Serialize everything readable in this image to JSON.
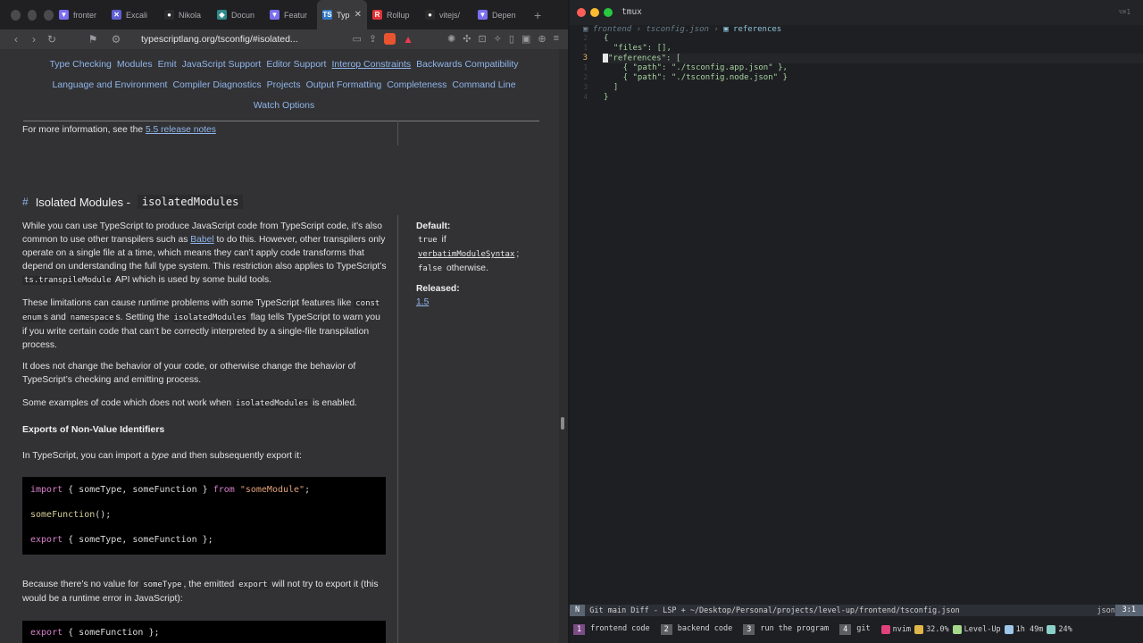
{
  "browser": {
    "tabs": [
      {
        "label": "fronter",
        "color": "#7a6ef0",
        "glyph": "▼"
      },
      {
        "label": "Excali",
        "color": "#5f5fd4",
        "glyph": "✕"
      },
      {
        "label": "Nikola",
        "color": "#2a2a2a",
        "glyph": "●"
      },
      {
        "label": "Docun",
        "color": "#2d8a8a",
        "glyph": "◆"
      },
      {
        "label": "Featur",
        "color": "#7a6ef0",
        "glyph": "▼"
      },
      {
        "label": "Typ",
        "color": "#3178c6",
        "glyph": "TS",
        "active": true
      },
      {
        "label": "Rollup",
        "color": "#e23237",
        "glyph": "R"
      },
      {
        "label": "vitejs/",
        "color": "#2a2a2a",
        "glyph": "●"
      },
      {
        "label": "Depen",
        "color": "#7a6ef0",
        "glyph": "▼"
      }
    ],
    "url": "typescriptlang.org/tsconfig/#isolated...",
    "shield_count": "2"
  },
  "page": {
    "nav_row1": [
      "Type Checking",
      "Modules",
      "Emit",
      "JavaScript Support",
      "Editor Support",
      "Interop Constraints",
      "Backwards Compatibility"
    ],
    "nav_row2": [
      "Language and Environment",
      "Compiler Diagnostics",
      "Projects",
      "Output Formatting",
      "Completeness",
      "Command Line"
    ],
    "nav_row3": [
      "Watch Options"
    ],
    "more_info_prefix": "For more information, see the ",
    "more_info_link": "5.5 release notes",
    "heading_hash": "#",
    "heading_text": "Isolated Modules -",
    "heading_code": "isolatedModules",
    "para1_a": "While you can use TypeScript to produce JavaScript code from TypeScript code, it’s also common to use other transpilers such as ",
    "para1_link": "Babel",
    "para1_b": " to do this. However, other transpilers only operate on a single file at a time, which means they can’t apply code transforms that depend on understanding the full type system. This restriction also applies to TypeScript’s ",
    "para1_code": "ts.transpileModule",
    "para1_c": " API which is used by some build tools.",
    "para2_a": "These limitations can cause runtime problems with some TypeScript features like ",
    "para2_code1": "const enum",
    "para2_b": "s and ",
    "para2_code2": "namespace",
    "para2_c": "s. Setting the ",
    "para2_code3": "isolatedModules",
    "para2_d": " flag tells TypeScript to warn you if you write certain code that can’t be correctly interpreted by a single-file transpilation process.",
    "para3": "It does not change the behavior of your code, or otherwise change the behavior of TypeScript’s checking and emitting process.",
    "para4_a": "Some examples of code which does not work when ",
    "para4_code": "isolatedModules",
    "para4_b": " is enabled.",
    "subheading": "Exports of Non-Value Identifiers",
    "para5_a": "In TypeScript, you can import a ",
    "para5_em": "type",
    "para5_b": " and then subsequently export it:",
    "code1_kw1": "import",
    "code1_mid": " { someType, someFunction } ",
    "code1_kw2": "from",
    "code1_str": " \"someModule\"",
    "code1_end": ";",
    "code2_fn": "someFunction",
    "code2_end": "();",
    "code3_kw": "export",
    "code3_rest": " { someType, someFunction };",
    "para6_a": "Because there’s no value for ",
    "para6_code1": "someType",
    "para6_b": ", the emitted ",
    "para6_code2": "export",
    "para6_c": " will not try to export it (this would be a runtime error in JavaScript):",
    "code4_kw": "export",
    "code4_rest": " { someFunction };",
    "side_default_label": "Default:",
    "side_default_true": "true",
    "side_default_if": " if",
    "side_default_link": "verbatimModuleSyntax",
    "side_default_semi": ";",
    "side_default_false": "false",
    "side_default_otherwise": " otherwise.",
    "side_released_label": "Released:",
    "side_released_link": "1.5"
  },
  "terminal": {
    "title": "tmux",
    "shortcut": "⌥⌘1",
    "crumbs": [
      "frontend",
      "tsconfig.json",
      "references"
    ],
    "lines": [
      {
        "num": "2",
        "text": "{"
      },
      {
        "num": "1",
        "text": "  \"files\": [],"
      },
      {
        "num": "3",
        "text": "\"references\": [",
        "current": true
      },
      {
        "num": "1",
        "text": "    { \"path\": \"./tsconfig.app.json\" },"
      },
      {
        "num": "2",
        "text": "    { \"path\": \"./tsconfig.node.json\" }"
      },
      {
        "num": "3",
        "text": "  ]"
      },
      {
        "num": "4",
        "text": "}"
      }
    ],
    "statusline": {
      "mode": "N",
      "info": " Git main Diff - LSP + ~/Desktop/Personal/projects/level-up/frontend/tsconfig.json",
      "filetype": "jsonc",
      "position": "3:1"
    },
    "tmux": {
      "windows": [
        {
          "index": "1",
          "name": "frontend code",
          "active": true
        },
        {
          "index": "2",
          "name": "backend code"
        },
        {
          "index": "3",
          "name": "run the program"
        },
        {
          "index": "4",
          "name": "git"
        }
      ],
      "nvim": "nvim",
      "cpu": "32.0%",
      "session": "Level-Up",
      "uptime": "1h 49m",
      "battery": "24%"
    }
  }
}
